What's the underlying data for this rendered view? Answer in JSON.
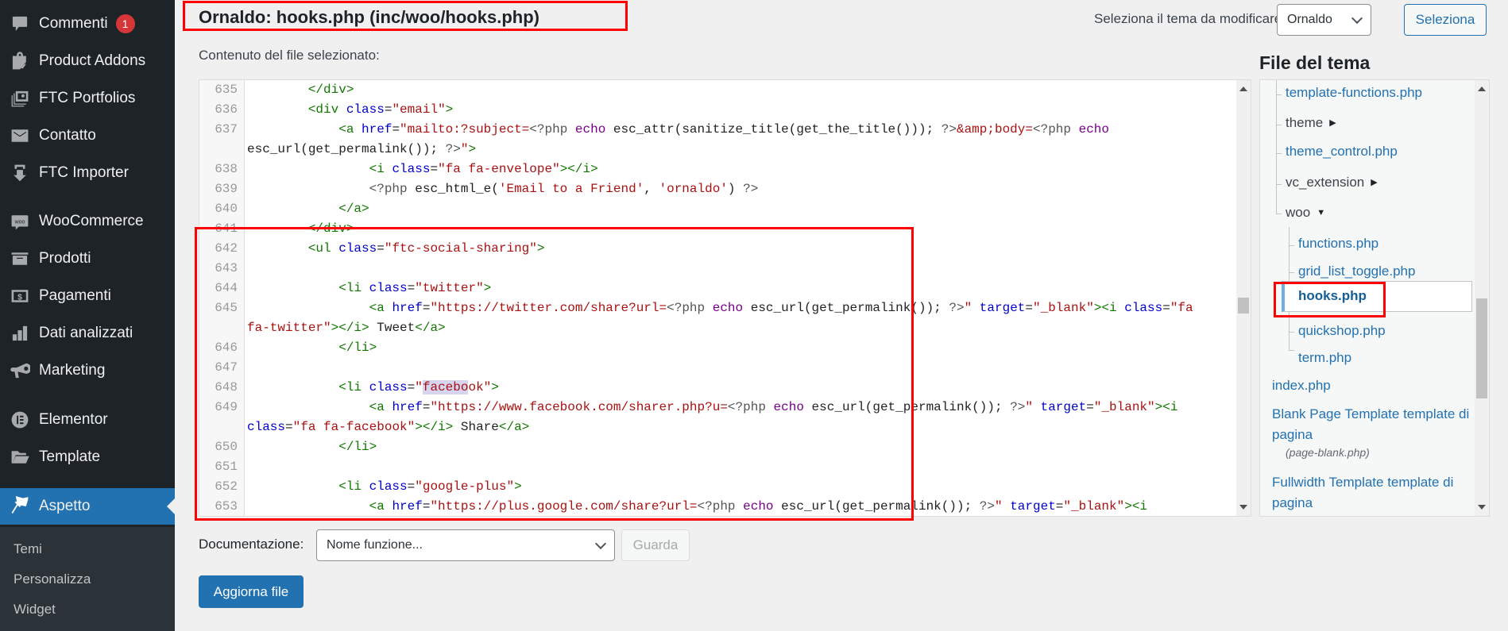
{
  "sidebar": {
    "items": [
      {
        "label": "Commenti",
        "icon": "comment-icon",
        "badge": "1"
      },
      {
        "label": "Product Addons",
        "icon": "shopping-bag-edit-icon"
      },
      {
        "label": "FTC Portfolios",
        "icon": "portfolio-images-icon"
      },
      {
        "label": "Contatto",
        "icon": "envelope-icon"
      },
      {
        "label": "FTC Importer",
        "icon": "import-arrow-icon"
      },
      {
        "label": "WooCommerce",
        "icon": "woocommerce-icon"
      },
      {
        "label": "Prodotti",
        "icon": "archive-box-icon"
      },
      {
        "label": "Pagamenti",
        "icon": "dollar-icon"
      },
      {
        "label": "Dati analizzati",
        "icon": "bar-chart-icon"
      },
      {
        "label": "Marketing",
        "icon": "megaphone-icon"
      },
      {
        "label": "Elementor",
        "icon": "elementor-icon"
      },
      {
        "label": "Template",
        "icon": "folder-open-icon"
      },
      {
        "label": "Aspetto",
        "icon": "paintbrush-icon",
        "active": true
      }
    ],
    "submenu": [
      "Temi",
      "Personalizza",
      "Widget"
    ]
  },
  "header": {
    "file_title": "Ornaldo: hooks.php (inc/woo/hooks.php)",
    "theme_select_label": "Seleziona il tema da modificare:",
    "theme_select_value": "Ornaldo",
    "select_button": "Seleziona"
  },
  "editor": {
    "label": "Contenuto del file selezionato:",
    "lines": [
      {
        "n": "635",
        "tokens": [
          [
            "p",
            "        "
          ],
          [
            "tag",
            "</div>"
          ]
        ]
      },
      {
        "n": "636",
        "tokens": [
          [
            "p",
            "        "
          ],
          [
            "tag",
            "<div "
          ],
          [
            "attr",
            "class"
          ],
          [
            "p",
            "="
          ],
          [
            "str",
            "\"email\""
          ],
          [
            "tag",
            ">"
          ]
        ]
      },
      {
        "n": "637",
        "tokens": [
          [
            "p",
            "            "
          ],
          [
            "tag",
            "<a "
          ],
          [
            "attr",
            "href"
          ],
          [
            "p",
            "="
          ],
          [
            "str",
            "\"mailto:?subject="
          ],
          [
            "meta",
            "<?php "
          ],
          [
            "kw",
            "echo"
          ],
          [
            "p",
            " esc_attr(sanitize_title(get_the_title())); "
          ],
          [
            "meta",
            "?>"
          ],
          [
            "str",
            "&amp;body="
          ],
          [
            "meta",
            "<?php "
          ],
          [
            "kw",
            "echo"
          ]
        ]
      },
      {
        "n": "",
        "tokens": [
          [
            "p",
            "esc_url(get_permalink()); "
          ],
          [
            "meta",
            "?>"
          ],
          [
            "str",
            "\""
          ],
          [
            "tag",
            ">"
          ]
        ]
      },
      {
        "n": "638",
        "tokens": [
          [
            "p",
            "                "
          ],
          [
            "tag",
            "<i "
          ],
          [
            "attr",
            "class"
          ],
          [
            "p",
            "="
          ],
          [
            "str",
            "\"fa fa-envelope\""
          ],
          [
            "tag",
            "></i>"
          ]
        ]
      },
      {
        "n": "639",
        "tokens": [
          [
            "p",
            "                "
          ],
          [
            "meta",
            "<?php "
          ],
          [
            "p",
            "esc_html_e("
          ],
          [
            "str",
            "'Email to a Friend'"
          ],
          [
            "p",
            ", "
          ],
          [
            "str",
            "'ornaldo'"
          ],
          [
            "p",
            ") "
          ],
          [
            "meta",
            "?>"
          ]
        ]
      },
      {
        "n": "640",
        "tokens": [
          [
            "p",
            "            "
          ],
          [
            "tag",
            "</a>"
          ]
        ]
      },
      {
        "n": "641",
        "tokens": [
          [
            "p",
            "        "
          ],
          [
            "tag",
            "</div>"
          ]
        ]
      },
      {
        "n": "642",
        "tokens": [
          [
            "p",
            "        "
          ],
          [
            "tag",
            "<ul "
          ],
          [
            "attr",
            "class"
          ],
          [
            "p",
            "="
          ],
          [
            "str",
            "\"ftc-social-sharing\""
          ],
          [
            "tag",
            ">"
          ]
        ]
      },
      {
        "n": "643",
        "tokens": []
      },
      {
        "n": "644",
        "tokens": [
          [
            "p",
            "            "
          ],
          [
            "tag",
            "<li "
          ],
          [
            "attr",
            "class"
          ],
          [
            "p",
            "="
          ],
          [
            "str",
            "\"twitter\""
          ],
          [
            "tag",
            ">"
          ]
        ]
      },
      {
        "n": "645",
        "tokens": [
          [
            "p",
            "                "
          ],
          [
            "tag",
            "<a "
          ],
          [
            "attr",
            "href"
          ],
          [
            "p",
            "="
          ],
          [
            "str",
            "\"https://twitter.com/share?url="
          ],
          [
            "meta",
            "<?php "
          ],
          [
            "kw",
            "echo"
          ],
          [
            "p",
            " esc_url(get_permalink()); "
          ],
          [
            "meta",
            "?>"
          ],
          [
            "str",
            "\" "
          ],
          [
            "attr",
            "target"
          ],
          [
            "p",
            "="
          ],
          [
            "str",
            "\"_blank\""
          ],
          [
            "tag",
            "><i "
          ],
          [
            "attr",
            "class"
          ],
          [
            "p",
            "="
          ],
          [
            "str",
            "\"fa"
          ]
        ]
      },
      {
        "n": "",
        "tokens": [
          [
            "str",
            "fa-twitter\""
          ],
          [
            "tag",
            "></i>"
          ],
          [
            "p",
            " Tweet"
          ],
          [
            "tag",
            "</a>"
          ]
        ]
      },
      {
        "n": "646",
        "tokens": [
          [
            "p",
            "            "
          ],
          [
            "tag",
            "</li>"
          ]
        ]
      },
      {
        "n": "647",
        "tokens": []
      },
      {
        "n": "648",
        "tokens": [
          [
            "p",
            "            "
          ],
          [
            "tag",
            "<li "
          ],
          [
            "attr",
            "class"
          ],
          [
            "p",
            "="
          ],
          [
            "str",
            "\""
          ],
          [
            "hl",
            "facebo"
          ],
          [
            "str",
            "ok\""
          ],
          [
            "tag",
            ">"
          ]
        ]
      },
      {
        "n": "649",
        "tokens": [
          [
            "p",
            "                "
          ],
          [
            "tag",
            "<a "
          ],
          [
            "attr",
            "href"
          ],
          [
            "p",
            "="
          ],
          [
            "str",
            "\"https://www.facebook.com/sharer.php?u="
          ],
          [
            "meta",
            "<?php "
          ],
          [
            "kw",
            "echo"
          ],
          [
            "p",
            " esc_url(get_permalink()); "
          ],
          [
            "meta",
            "?>"
          ],
          [
            "str",
            "\" "
          ],
          [
            "attr",
            "target"
          ],
          [
            "p",
            "="
          ],
          [
            "str",
            "\"_blank\""
          ],
          [
            "tag",
            "><i"
          ]
        ]
      },
      {
        "n": "",
        "tokens": [
          [
            "attr",
            "class"
          ],
          [
            "p",
            "="
          ],
          [
            "str",
            "\"fa fa-facebook\""
          ],
          [
            "tag",
            "></i>"
          ],
          [
            "p",
            " Share"
          ],
          [
            "tag",
            "</a>"
          ]
        ]
      },
      {
        "n": "650",
        "tokens": [
          [
            "p",
            "            "
          ],
          [
            "tag",
            "</li>"
          ]
        ]
      },
      {
        "n": "651",
        "tokens": []
      },
      {
        "n": "652",
        "tokens": [
          [
            "p",
            "            "
          ],
          [
            "tag",
            "<li "
          ],
          [
            "attr",
            "class"
          ],
          [
            "p",
            "="
          ],
          [
            "str",
            "\"google-plus\""
          ],
          [
            "tag",
            ">"
          ]
        ]
      },
      {
        "n": "653",
        "tokens": [
          [
            "p",
            "                "
          ],
          [
            "tag",
            "<a "
          ],
          [
            "attr",
            "href"
          ],
          [
            "p",
            "="
          ],
          [
            "str",
            "\"https://plus.google.com/share?url="
          ],
          [
            "meta",
            "<?php "
          ],
          [
            "kw",
            "echo"
          ],
          [
            "p",
            " esc_url(get_permalink()); "
          ],
          [
            "meta",
            "?>"
          ],
          [
            "str",
            "\" "
          ],
          [
            "attr",
            "target"
          ],
          [
            "p",
            "="
          ],
          [
            "str",
            "\"_blank\""
          ],
          [
            "tag",
            "><i"
          ]
        ]
      }
    ]
  },
  "file_tree": {
    "title": "File del tema",
    "items": {
      "template_functions": "template-functions.php",
      "theme": "theme",
      "theme_control": "theme_control.php",
      "vc_extension": "vc_extension",
      "woo": "woo",
      "functions": "functions.php",
      "grid_list_toggle": "grid_list_toggle.php",
      "hooks": "hooks.php",
      "quickshop": "quickshop.php",
      "term": "term.php",
      "index": "index.php",
      "blank_page_template": "Blank Page Template template di pagina",
      "blank_page_file": "(page-blank.php)",
      "fullwidth_template": "Fullwidth Template template di pagina"
    },
    "caret_collapsed": "▶",
    "caret_expanded": "▼"
  },
  "documentation": {
    "label": "Documentazione:",
    "select_placeholder": "Nome funzione...",
    "lookup_button": "Guarda"
  },
  "update_button": "Aggiorna file"
}
